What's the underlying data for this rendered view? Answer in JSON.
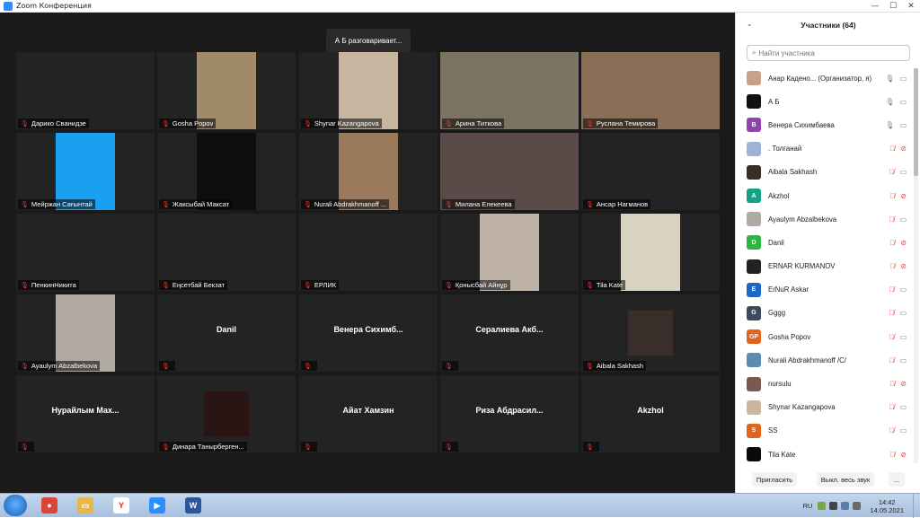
{
  "window": {
    "title": "Zoom Конференция",
    "controls": [
      "—",
      "☐",
      "✕"
    ]
  },
  "meeting": {
    "speaking_banner": "А Б разговаривает...",
    "tiles": [
      {
        "name": "Дарико Сванидзе",
        "big": "",
        "video": ""
      },
      {
        "name": "Gosha Popov",
        "big": "",
        "video": "#a08a6a"
      },
      {
        "name": "Shynar Kazangapova",
        "big": "",
        "video": "#c9b6a0"
      },
      {
        "name": "Арина Титкова",
        "big": "",
        "video": "#7d7363"
      },
      {
        "name": "Руслана Темирова",
        "big": "",
        "video": "#8a6e55"
      },
      {
        "name": "Мейржан Сағынтай",
        "big": "",
        "video": "#1aa0f0"
      },
      {
        "name": "Жаксыбай Максат",
        "big": "",
        "video": "#0e0e0e"
      },
      {
        "name": "Nurali Abdrakhmanoff ...",
        "big": "",
        "video": "#9a7a5a"
      },
      {
        "name": "Милана Елекеева",
        "big": "",
        "video": "#5a4a48"
      },
      {
        "name": "Ансар Нагманов",
        "big": "",
        "video": ""
      },
      {
        "name": "ПенкинНикита",
        "big": "",
        "video": ""
      },
      {
        "name": "Еңсетбай Бекзат",
        "big": "",
        "video": ""
      },
      {
        "name": "ЕРЛИК",
        "big": "",
        "video": ""
      },
      {
        "name": "Қонысбай Айнұр",
        "big": "",
        "video": "#bfb3a8"
      },
      {
        "name": "Tila Kate",
        "big": "",
        "video": "#d8d2c0"
      },
      {
        "name": "Ayaulym Abzalbekova",
        "big": "",
        "video": "#b0a9a2"
      },
      {
        "name": "",
        "big": "Danil",
        "video": ""
      },
      {
        "name": "",
        "big": "Венера Сихимб...",
        "video": ""
      },
      {
        "name": "",
        "big": "Сералиева Акб...",
        "video": ""
      },
      {
        "name": "Aibala Sakhash",
        "big": "",
        "video": "#3a2e2a"
      },
      {
        "name": "",
        "big": "Нурайлым Мах...",
        "video": ""
      },
      {
        "name": "Динара Танырберген...",
        "big": "",
        "video": "#2a1414"
      },
      {
        "name": "",
        "big": "Айат Хамзин",
        "video": ""
      },
      {
        "name": "",
        "big": "Риза Абдрасил...",
        "video": ""
      },
      {
        "name": "",
        "big": "Akzhol",
        "video": ""
      }
    ]
  },
  "panel": {
    "title": "Участники (64)",
    "search_placeholder": "Найти участника",
    "participants": [
      {
        "name": "Анар Каденo...   (Организатор, я)",
        "initials": "",
        "color": "#c9a088",
        "mic": "on",
        "cam": "on"
      },
      {
        "name": "А Б",
        "initials": "",
        "color": "#111111",
        "mic": "on",
        "cam": "on"
      },
      {
        "name": "Венера Сихимбаева",
        "initials": "В",
        "color": "#8e44ad",
        "mic": "on",
        "cam": "on"
      },
      {
        "name": ". Толганай",
        "initials": "",
        "color": "#9fb3d9",
        "mic": "muted",
        "cam": "off"
      },
      {
        "name": "Aibala Sakhash",
        "initials": "",
        "color": "#3a2e2a",
        "mic": "muted",
        "cam": "on"
      },
      {
        "name": "Akzhol",
        "initials": "A",
        "color": "#16a085",
        "mic": "muted",
        "cam": "off"
      },
      {
        "name": "Ayaulym Abzalbekova",
        "initials": "",
        "color": "#b0a9a2",
        "mic": "muted",
        "cam": "on"
      },
      {
        "name": "Danil",
        "initials": "D",
        "color": "#2fb344",
        "mic": "muted",
        "cam": "off"
      },
      {
        "name": "ERNAR KURMANOV",
        "initials": "",
        "color": "#222222",
        "mic": "muted",
        "cam": "off"
      },
      {
        "name": "ErNuR Askar",
        "initials": "E",
        "color": "#2166c4",
        "mic": "muted",
        "cam": "on"
      },
      {
        "name": "Gggg",
        "initials": "G",
        "color": "#3b4a5a",
        "mic": "muted",
        "cam": "on"
      },
      {
        "name": "Gosha Popov",
        "initials": "GP",
        "color": "#e2641b",
        "mic": "muted",
        "cam": "on"
      },
      {
        "name": "Nurali Abdrakhmanoff /C/",
        "initials": "",
        "color": "#5d8bb0",
        "mic": "muted",
        "cam": "on"
      },
      {
        "name": "nursulu",
        "initials": "",
        "color": "#7a5a50",
        "mic": "muted",
        "cam": "off"
      },
      {
        "name": "Shynar Kazangapova",
        "initials": "",
        "color": "#c9b6a0",
        "mic": "muted",
        "cam": "on"
      },
      {
        "name": "SS",
        "initials": "S",
        "color": "#e2641b",
        "mic": "muted",
        "cam": "on"
      },
      {
        "name": "Tila Kate",
        "initials": "",
        "color": "#0a0a0a",
        "mic": "muted",
        "cam": "off"
      }
    ],
    "invite_label": "Пригласить",
    "mute_all_label": "Выкл. весь звук",
    "more_label": "..."
  },
  "taskbar": {
    "apps": [
      {
        "name": "chrome",
        "color": "#db4437",
        "glyph": "●"
      },
      {
        "name": "folder",
        "color": "#e6b84a",
        "glyph": "▭"
      },
      {
        "name": "yandex",
        "color": "#ffffff",
        "glyph": "Y"
      },
      {
        "name": "zoom",
        "color": "#2d8cff",
        "glyph": "▶"
      },
      {
        "name": "word",
        "color": "#2b579a",
        "glyph": "W"
      }
    ],
    "lang": "RU",
    "time": "14:42",
    "date": "14.05.2021"
  }
}
